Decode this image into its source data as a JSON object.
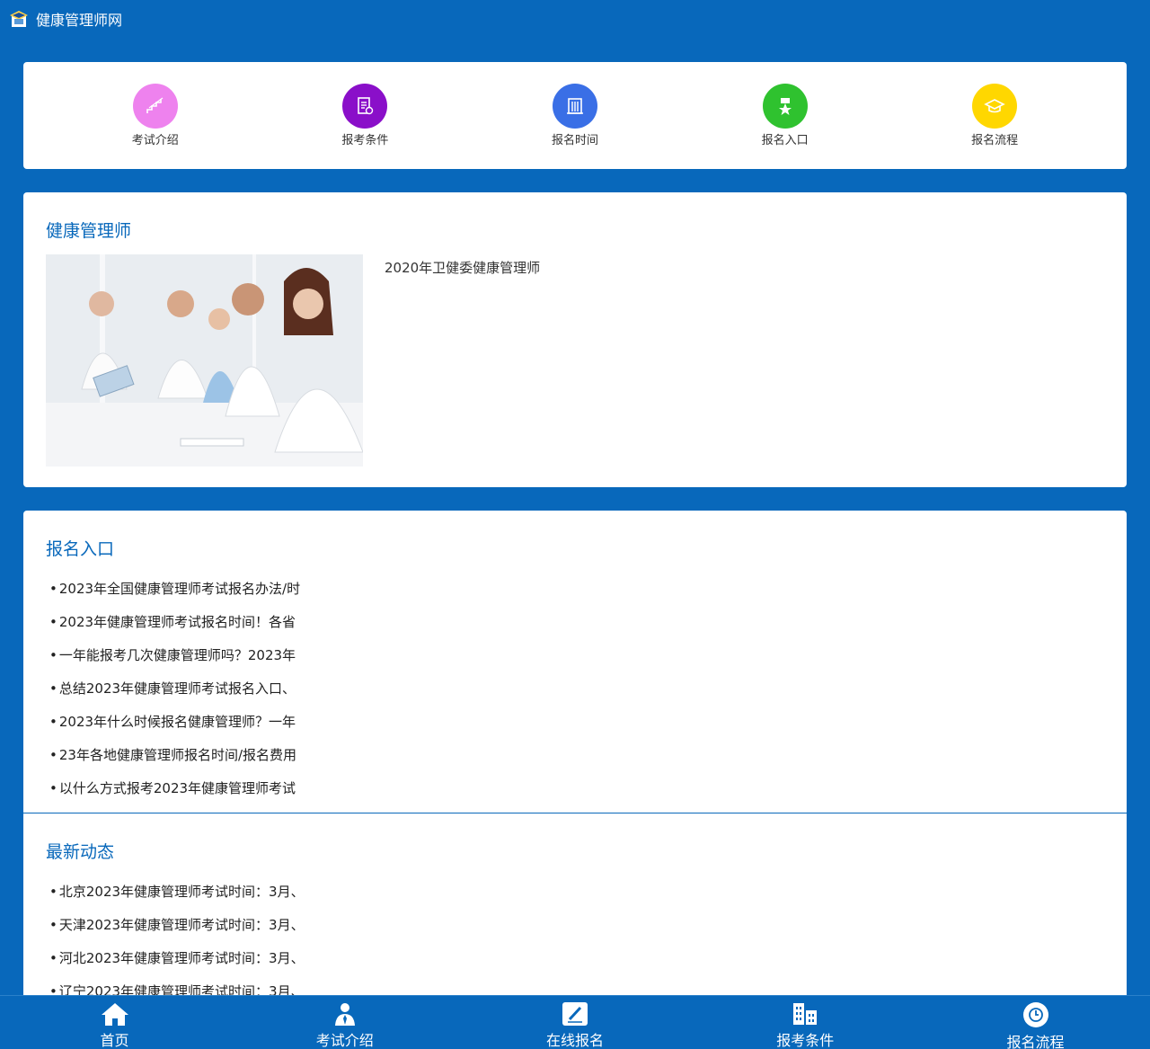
{
  "header": {
    "site_title": "健康管理师网"
  },
  "quick_nav": [
    {
      "label": "考试介绍",
      "color": "#ee82ee",
      "icon": "stairs-icon"
    },
    {
      "label": "报考条件",
      "color": "#8a0fc9",
      "icon": "document-icon"
    },
    {
      "label": "报名时间",
      "color": "#3a6fe6",
      "icon": "building-icon"
    },
    {
      "label": "报名入口",
      "color": "#2fc22f",
      "icon": "medal-icon"
    },
    {
      "label": "报名流程",
      "color": "#ffd700",
      "icon": "graduation-cap-icon"
    }
  ],
  "intro": {
    "title": "健康管理师",
    "text": "2020年卫健委健康管理师"
  },
  "registration": {
    "title": "报名入口",
    "items": [
      "2023年全国健康管理师考试报名办法/时",
      "2023年健康管理师考试报名时间！各省",
      "一年能报考几次健康管理师吗？2023年",
      "总结2023年健康管理师考试报名入口、",
      "2023年什么时候报名健康管理师？一年",
      "23年各地健康管理师报名时间/报名费用",
      "以什么方式报考2023年健康管理师考试"
    ]
  },
  "news": {
    "title": "最新动态",
    "items": [
      "北京2023年健康管理师考试时间：3月、",
      "天津2023年健康管理师考试时间：3月、",
      "河北2023年健康管理师考试时间：3月、",
      "辽宁2023年健康管理师考试时间：3月、"
    ]
  },
  "bottom_tabs": [
    {
      "label": "首页",
      "icon": "home-icon"
    },
    {
      "label": "考试介绍",
      "icon": "person-icon"
    },
    {
      "label": "在线报名",
      "icon": "edit-icon"
    },
    {
      "label": "报考条件",
      "icon": "buildings-icon"
    },
    {
      "label": "报名流程",
      "icon": "clock-icon"
    }
  ]
}
